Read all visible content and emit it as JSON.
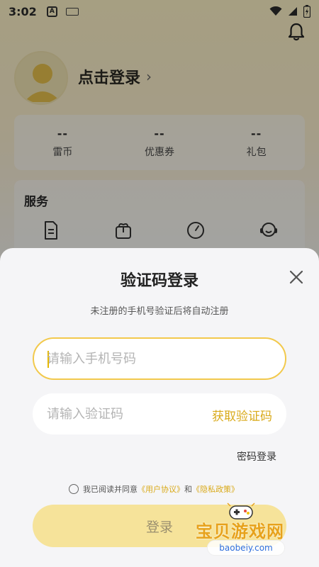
{
  "status_bar": {
    "time": "3:02",
    "a_icon_letter": "A"
  },
  "profile": {
    "login_link": "点击登录",
    "chevron": "›"
  },
  "stats": [
    {
      "value": "--",
      "label": "雷币"
    },
    {
      "value": "--",
      "label": "优惠券"
    },
    {
      "value": "--",
      "label": "礼包"
    }
  ],
  "services": {
    "title": "服务"
  },
  "login_sheet": {
    "title": "验证码登录",
    "subtitle": "未注册的手机号验证后将自动注册",
    "phone_placeholder": "请输入手机号码",
    "code_placeholder": "请输入验证码",
    "get_code": "获取验证码",
    "password_login": "密码登录",
    "agreement_prefix": "我已阅读并同意",
    "user_agreement": "《用户协议》",
    "and": "和",
    "privacy_policy": "《隐私政策》",
    "login_button": "登录"
  },
  "watermark": {
    "title": "宝贝游戏网",
    "url": "baobeiy.com"
  },
  "colors": {
    "accent": "#f2c94c",
    "link": "#d9aa1a",
    "button_disabled": "#f6e39a"
  }
}
